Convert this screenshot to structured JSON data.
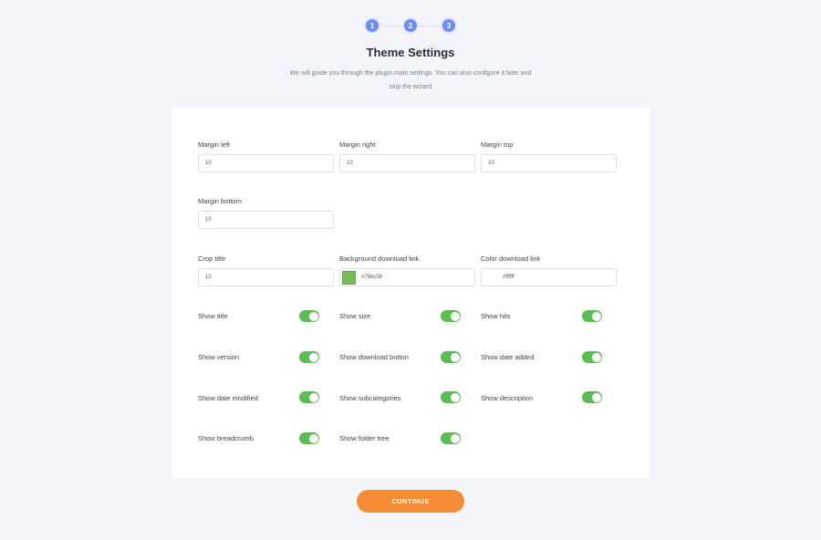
{
  "stepper": {
    "steps": [
      "1",
      "2",
      "3"
    ]
  },
  "header": {
    "title": "Theme Settings",
    "subtitle_line1": "We will guide you through the plugin main settings. You can also configure it later and",
    "subtitle_line2": "skip the wizard"
  },
  "fields": {
    "margin_left": {
      "label": "Margin left",
      "value": "10"
    },
    "margin_right": {
      "label": "Margin right",
      "value": "10"
    },
    "margin_top": {
      "label": "Margin top",
      "value": "10"
    },
    "margin_bottom": {
      "label": "Margin bottom",
      "value": "10"
    },
    "crop_title": {
      "label": "Crop title",
      "value": "10"
    },
    "bg_download_link": {
      "label": "Background download link",
      "value": "#76bc58",
      "swatch_color": "#76bc58"
    },
    "color_download_link": {
      "label": "Color download link",
      "value": "#ffffff",
      "swatch_color": "#ffffff"
    }
  },
  "toggles": [
    {
      "label": "Show title",
      "on": true
    },
    {
      "label": "Show size",
      "on": true
    },
    {
      "label": "Show hits",
      "on": true
    },
    {
      "label": "Show version",
      "on": true
    },
    {
      "label": "Show download button",
      "on": true
    },
    {
      "label": "Show date added",
      "on": true
    },
    {
      "label": "Show date modified",
      "on": true
    },
    {
      "label": "Show subcategories",
      "on": true
    },
    {
      "label": "Show description",
      "on": true
    },
    {
      "label": "Show breadcrumb",
      "on": true
    },
    {
      "label": "Show folder tree",
      "on": true
    }
  ],
  "footer": {
    "continue_label": "CONTINUE"
  },
  "colors": {
    "accent": "#6e8cf2",
    "toggle_on": "#5cbd55",
    "button": "#f58b35",
    "background": "#f3f5fa"
  }
}
